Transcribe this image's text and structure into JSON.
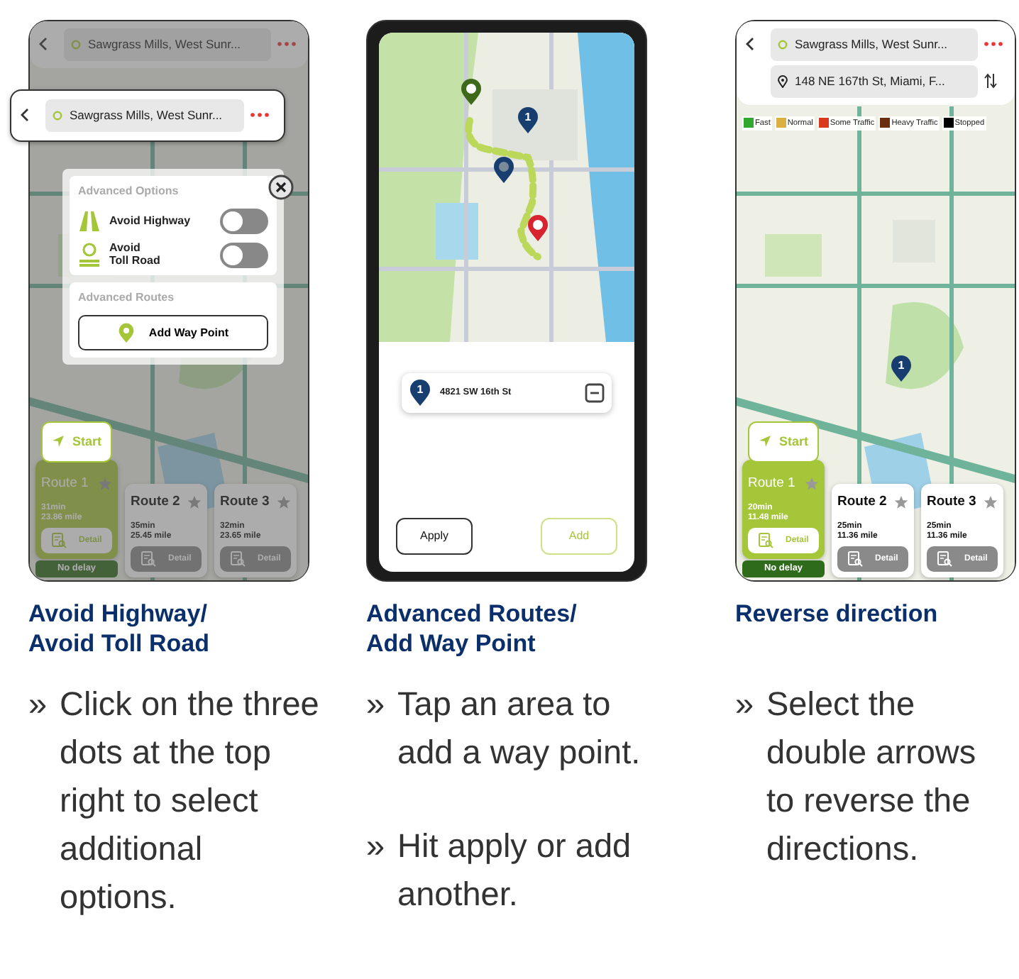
{
  "panels": [
    {
      "kind": "route_options",
      "phone": {
        "dimmed": true,
        "fields": [
          {
            "kind": "origin",
            "text": "Sawgrass Mills, West Sunr..."
          }
        ],
        "callout": {
          "fields": [
            {
              "kind": "origin",
              "text": "Sawgrass Mills, West Sunr..."
            }
          ]
        },
        "options": {
          "sections": [
            {
              "title": "Advanced Options",
              "toggles": [
                {
                  "kind": "road",
                  "label": "Avoid Highway",
                  "on": false
                },
                {
                  "kind": "toll",
                  "label": "Avoid\nToll Road",
                  "on": false
                }
              ]
            },
            {
              "title": "Advanced Routes",
              "button": "Add Way Point"
            }
          ]
        },
        "start": "Start",
        "routes": [
          {
            "name": "Route 1",
            "time": "31min",
            "distance": "23.86 mile",
            "detail": "Detail",
            "selected": true
          },
          {
            "name": "Route 2",
            "time": "35min",
            "distance": "25.45 mile",
            "detail": "Detail",
            "selected": false
          },
          {
            "name": "Route 3",
            "time": "32min",
            "distance": "23.65 mile",
            "detail": "Detail",
            "selected": false
          }
        ],
        "status": "No delay"
      },
      "heading": "Avoid Highway/\nAvoid Toll Road",
      "bullets": [
        {
          "marker": "»",
          "text": "Click on the three dots at the top right to select additional options."
        }
      ]
    },
    {
      "kind": "way_point",
      "phone": {
        "markers": [
          {
            "kind": "start"
          },
          {
            "kind": "waypoint",
            "number": "1"
          },
          {
            "kind": "pending"
          },
          {
            "kind": "end"
          }
        ],
        "waypoints": [
          {
            "number": "1",
            "address": "4821 SW 16th St"
          }
        ],
        "buttons": [
          {
            "kind": "primary",
            "label": "Apply"
          },
          {
            "kind": "accent",
            "label": "Add"
          }
        ]
      },
      "heading": "Advanced Routes/\nAdd Way Point",
      "bullets": [
        {
          "marker": "»",
          "text": "Tap an area to add a way point."
        },
        {
          "marker": "»",
          "text": "Hit apply or add another."
        }
      ]
    },
    {
      "kind": "reverse",
      "phone": {
        "dimmed": false,
        "fields": [
          {
            "kind": "origin",
            "text": "Sawgrass Mills, West Sunr..."
          },
          {
            "kind": "destination",
            "text": "148 NE 167th St, Miami, F..."
          }
        ],
        "legend": [
          {
            "label": "Fast",
            "color": "#2ea82e"
          },
          {
            "label": "Normal",
            "color": "#dcb040"
          },
          {
            "label": "Some Traffic",
            "color": "#d93a1e"
          },
          {
            "label": "Heavy Traffic",
            "color": "#6b2e0e"
          },
          {
            "label": "Stopped",
            "color": "#000000"
          }
        ],
        "markers": [
          {
            "kind": "waypoint",
            "number": "1"
          }
        ],
        "start": "Start",
        "routes": [
          {
            "name": "Route 1",
            "time": "20min",
            "distance": "11.48 mile",
            "detail": "Detail",
            "selected": true
          },
          {
            "name": "Route 2",
            "time": "25min",
            "distance": "11.36 mile",
            "detail": "Detail",
            "selected": false
          },
          {
            "name": "Route 3",
            "time": "25min",
            "distance": "11.36 mile",
            "detail": "Detail",
            "selected": false
          }
        ],
        "status": "No delay"
      },
      "heading": "Reverse direction",
      "bullets": [
        {
          "marker": "»",
          "text": "Select the double arrows to reverse the directions."
        }
      ]
    }
  ]
}
